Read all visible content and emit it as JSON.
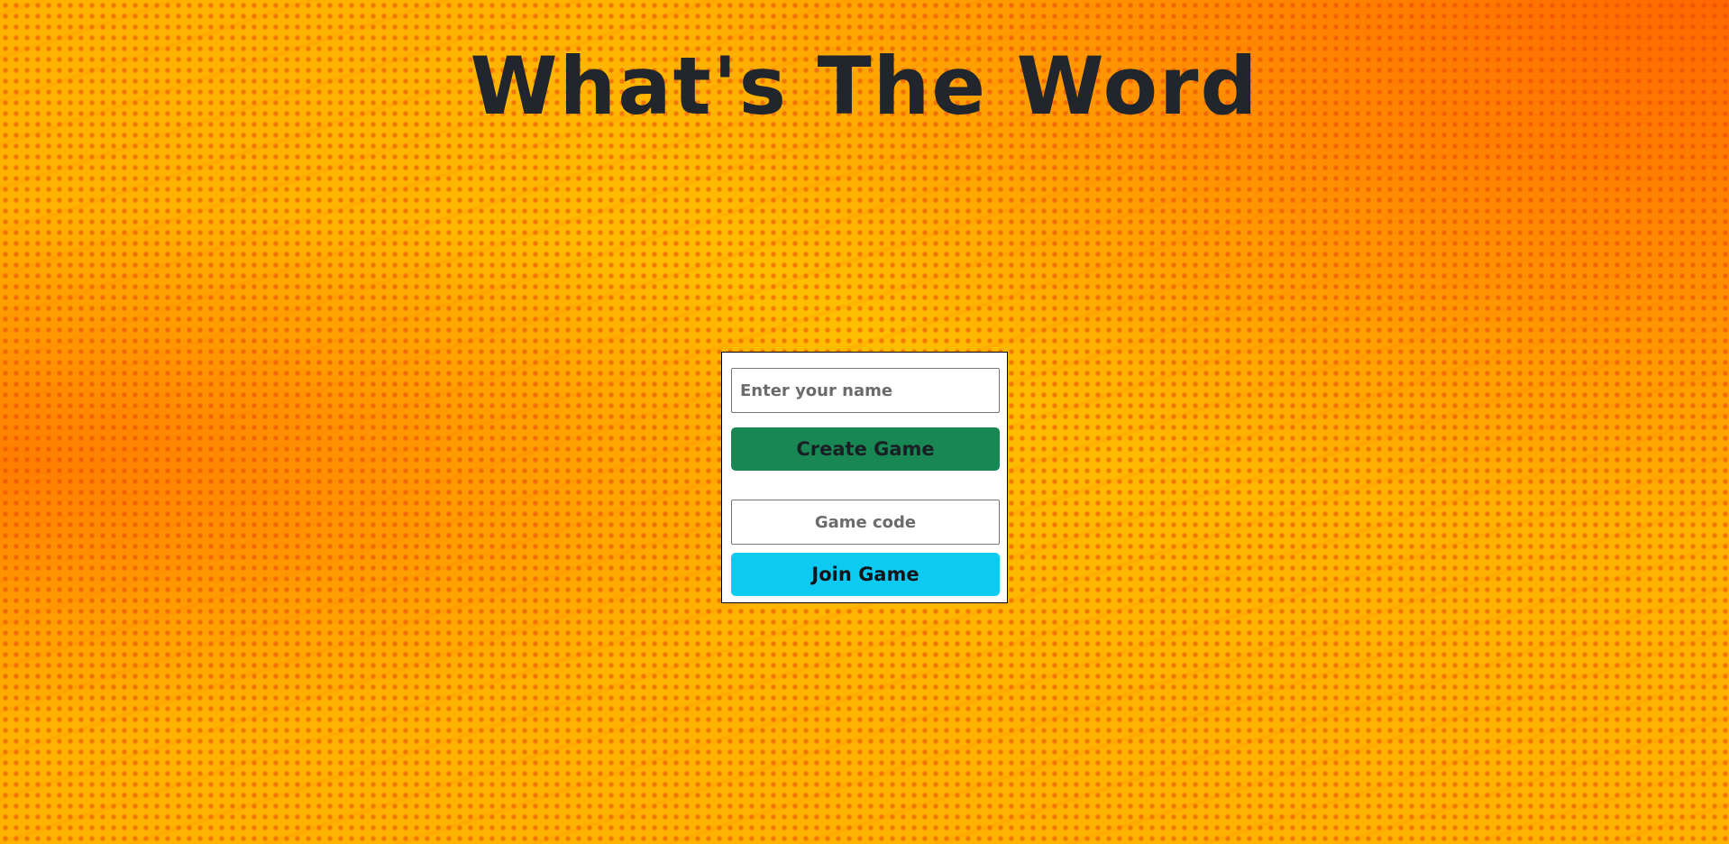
{
  "page": {
    "title": "What's The Word"
  },
  "form": {
    "name_input": {
      "value": "",
      "placeholder": "Enter your name"
    },
    "create_button_label": "Create Game",
    "code_input": {
      "value": "",
      "placeholder": "Game code"
    },
    "join_button_label": "Join Game"
  },
  "colors": {
    "background": "#ffb300",
    "halftone_dots": "#e8460a",
    "title_text": "#20262c",
    "create_button": "#198754",
    "join_button": "#0dcaf0",
    "panel_background": "#ffffff"
  }
}
